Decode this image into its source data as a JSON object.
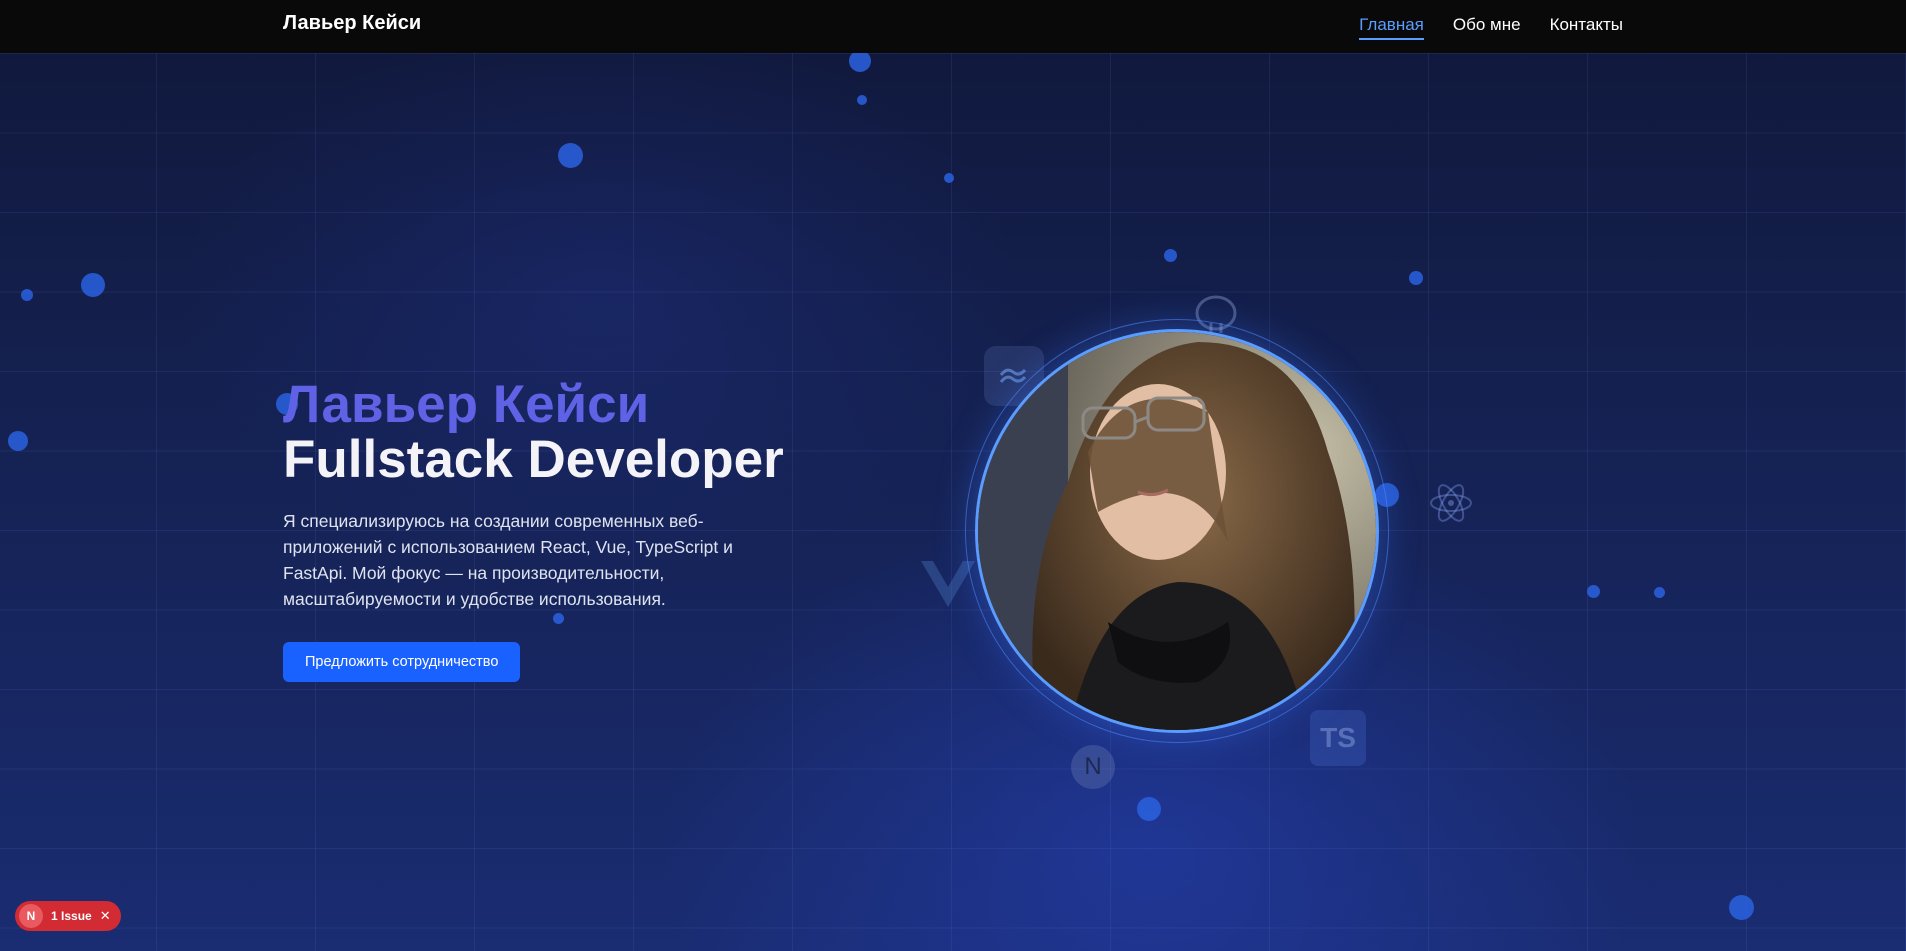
{
  "header": {
    "brand": "Лавьер Кейси",
    "nav": [
      {
        "label": "Главная",
        "active": true
      },
      {
        "label": "Обо мне",
        "active": false
      },
      {
        "label": "Контакты",
        "active": false
      }
    ]
  },
  "hero": {
    "name": "Лавьер Кейси",
    "role": "Fullstack Developer",
    "description": "Я специализируюсь на создании современных веб-приложений с использованием React, Vue, TypeScript и FastApi. Мой фокус — на производительности, масштабируемости и удобстве использования.",
    "cta_label": "Предложить сотрудничество"
  },
  "tech_icons": [
    "postgresql-icon",
    "tailwind-icon",
    "react-icon",
    "vue-icon",
    "typescript-icon",
    "nextjs-icon"
  ],
  "typescript_badge": "TS",
  "nextjs_badge": "N",
  "devtools": {
    "badge_letter": "N",
    "issue_label": "1 Issue",
    "close_glyph": "✕"
  },
  "colors": {
    "accent": "#5b9cff",
    "name_color": "#6062e6",
    "cta_bg": "#1a62ff",
    "issue_bg": "#d22b33"
  }
}
